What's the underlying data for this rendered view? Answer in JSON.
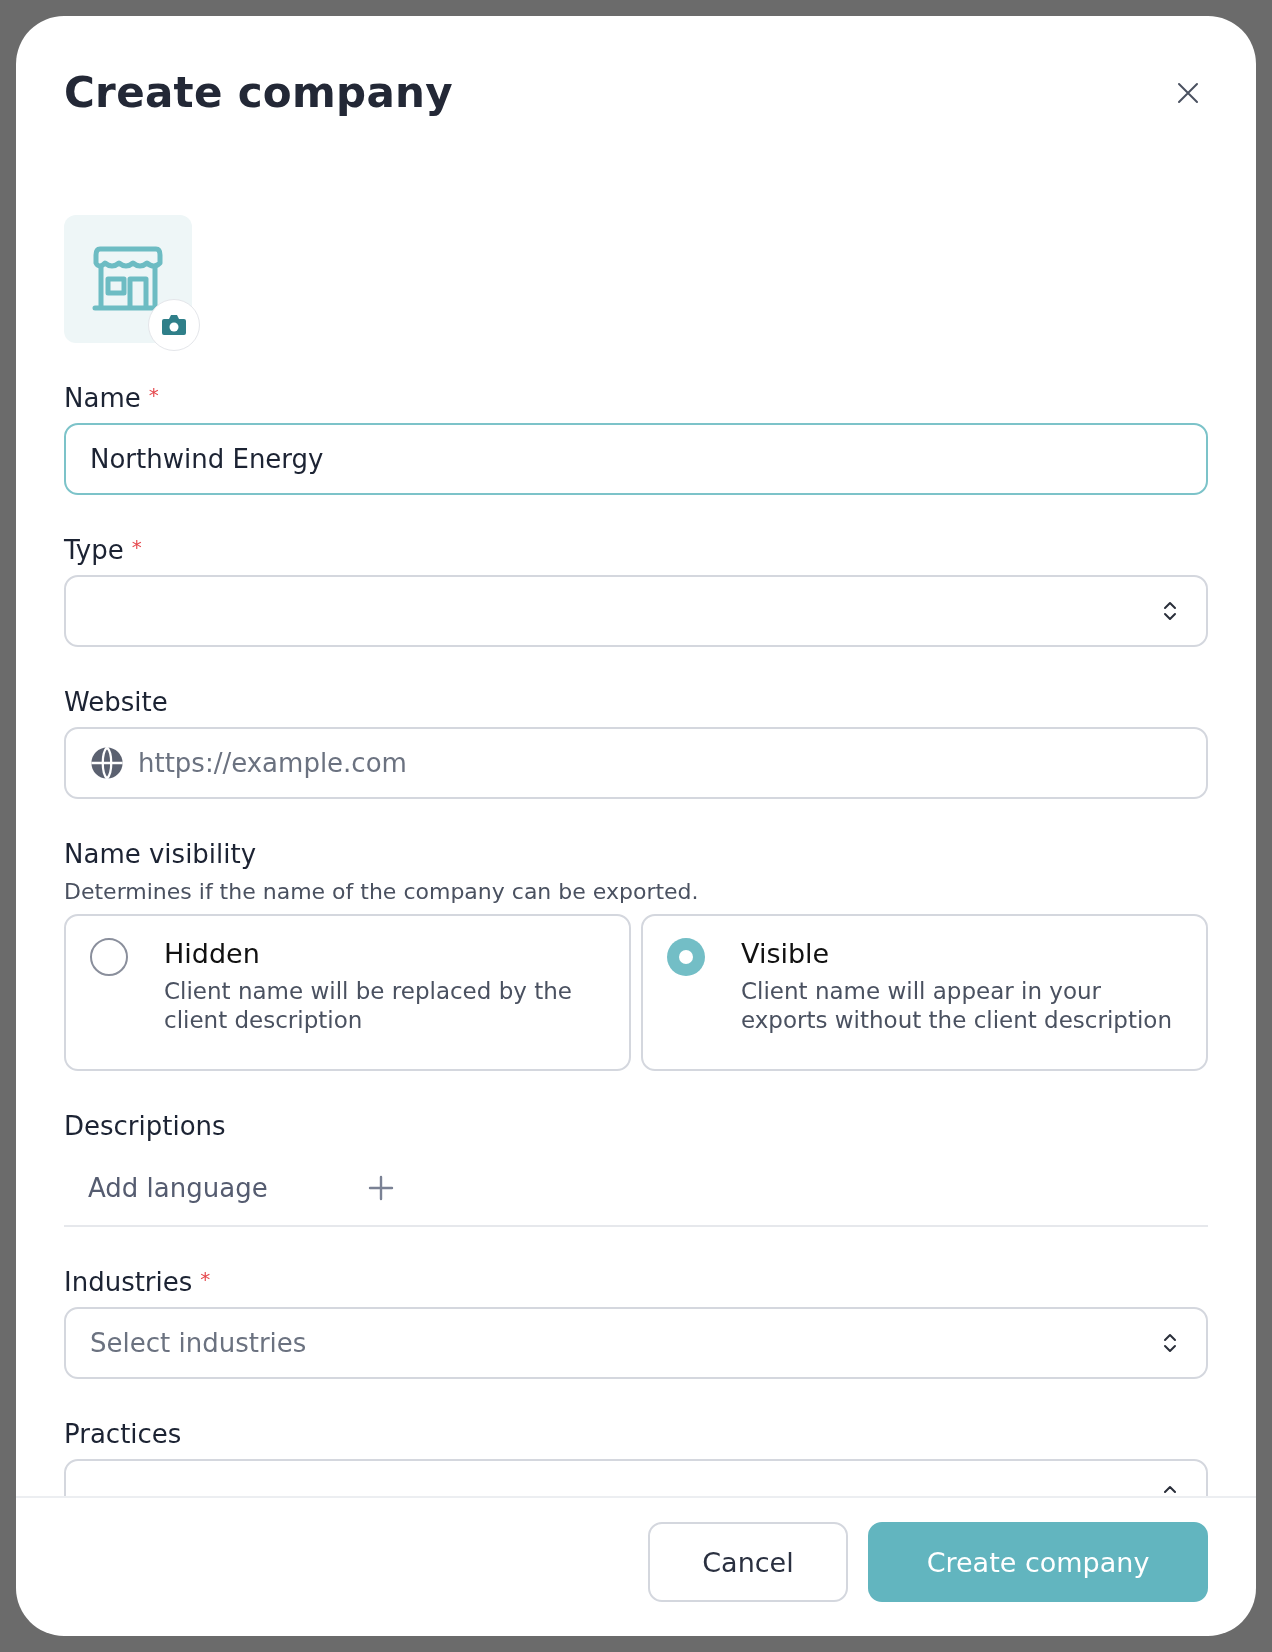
{
  "dialog": {
    "title": "Create company"
  },
  "fields": [
    {
      "kind": "text",
      "label": "Name",
      "required_mark": "*",
      "value": "Northwind Energy",
      "focused": true
    },
    {
      "kind": "select",
      "label": "Type",
      "required_mark": "*",
      "focused": false
    },
    {
      "kind": "url",
      "label": "Website",
      "placeholder": "https://example.com",
      "focused": false
    }
  ],
  "name_visibility": {
    "label": "Name visibility",
    "hint": "Determines if the name of the company can be exported.",
    "options": [
      {
        "title": "Hidden",
        "description": "Client name will be replaced by the client description",
        "selected": false
      },
      {
        "title": "Visible",
        "description": "Client name will appear in your exports without the client description",
        "selected": true
      }
    ]
  },
  "descriptions": {
    "label": "Descriptions",
    "add_button": "Add language"
  },
  "fields_after": [
    {
      "kind": "select",
      "label": "Industries",
      "required_mark": "*",
      "placeholder": "Select industries",
      "focused": false
    },
    {
      "kind": "select",
      "label": "Practices"
    }
  ],
  "buttons": [
    {
      "kind": "secondary",
      "label": "Cancel"
    },
    {
      "kind": "primary",
      "label": "Create company"
    }
  ]
}
